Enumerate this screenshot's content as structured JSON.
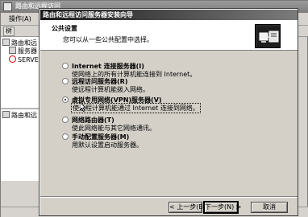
{
  "background_window": {
    "title": "路由和远程访问",
    "menu": "操作(A)",
    "tab_label": "树",
    "tree": {
      "root": "路由和远",
      "child": "服务器",
      "server": "SERVER"
    },
    "lower_tree_root": "路由和远"
  },
  "wizard": {
    "title": "路由和远程访问服务器安装向导",
    "header_title": "公共设置",
    "header_subtitle": "您可以从一些公共配置中选择。",
    "header_icon": "network-server-icon",
    "options": [
      {
        "label": "Internet 连接服务器(I)",
        "description": "使网络上的所有计算机能连接到 Internet。",
        "selected": false
      },
      {
        "label": "远程访问服务器(R)",
        "description": "使远程计算机能拨入网络。",
        "selected": false
      },
      {
        "label": "虚拟专用网络(VPN)服务器(V)",
        "description": "使远程计算机能通过 Internet 连接到网络。",
        "selected": true
      },
      {
        "label": "网络路由器(T)",
        "description": "使此网络能与其它网络通讯。",
        "selected": false
      },
      {
        "label": "手动配置服务器(M)",
        "description": "用默认设置启动服务器。",
        "selected": false
      }
    ],
    "buttons": {
      "back": "< 上一步(B)",
      "next": "下一步(N) >",
      "cancel": "取消"
    }
  }
}
